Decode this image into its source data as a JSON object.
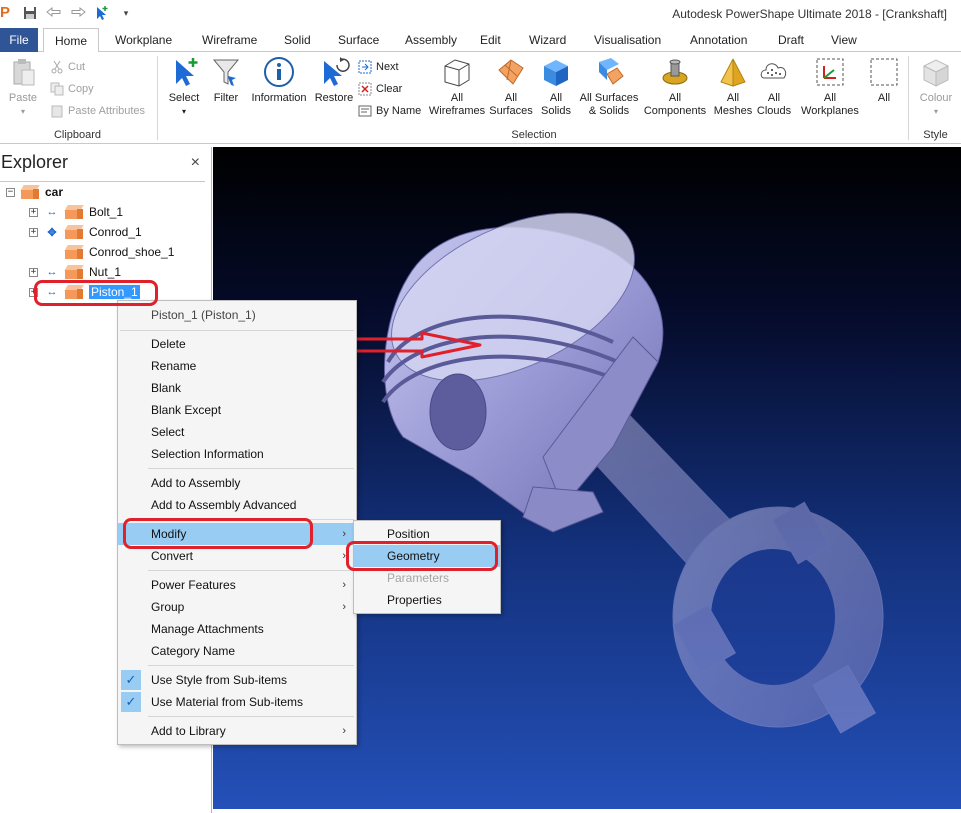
{
  "window": {
    "title": "Autodesk PowerShape Ultimate 2018 - [Crankshaft]",
    "app_logo": "P"
  },
  "ribbon_tabs": [
    "File",
    "Home",
    "Workplane",
    "Wireframe",
    "Solid",
    "Surface",
    "Assembly",
    "Edit",
    "Wizard",
    "Visualisation",
    "Annotation",
    "Draft",
    "View"
  ],
  "ribbon": {
    "clipboard": {
      "label": "Clipboard",
      "paste": "Paste",
      "cut": "Cut",
      "copy": "Copy",
      "paste_attributes": "Paste Attributes"
    },
    "selection": {
      "label": "Selection",
      "select": "Select",
      "filter": "Filter",
      "information": "Information",
      "restore": "Restore",
      "next": "Next",
      "clear": "Clear",
      "by_name": "By Name",
      "all_wireframes": [
        "All",
        "Wireframes"
      ],
      "all_surfaces": [
        "All",
        "Surfaces"
      ],
      "all_solids": [
        "All",
        "Solids"
      ],
      "all_surfaces_solids": [
        "All Surfaces",
        "& Solids"
      ],
      "all_components": [
        "All",
        "Components"
      ],
      "all_meshes": [
        "All",
        "Meshes"
      ],
      "all_clouds": [
        "All",
        "Clouds"
      ],
      "all_workplanes": [
        "All",
        "Workplanes"
      ],
      "all": "All"
    },
    "style": {
      "label": "Style",
      "colour": "Colour"
    }
  },
  "explorer": {
    "title": "Explorer",
    "close": "×",
    "root": "car",
    "items": [
      "Bolt_1",
      "Conrod_1",
      "Conrod_shoe_1",
      "Nut_1",
      "Piston_1"
    ]
  },
  "context_menu": {
    "header": "Piston_1 (Piston_1)",
    "groups": [
      [
        "Delete",
        "Rename",
        "Blank",
        "Blank Except",
        "Select",
        "Selection Information"
      ],
      [
        "Add to Assembly",
        "Add to Assembly Advanced"
      ],
      [
        "Modify",
        "Convert"
      ],
      [
        "Power Features",
        "Group",
        "Manage Attachments",
        "Category Name"
      ],
      [
        "Use Style from Sub-items",
        "Use Material from Sub-items"
      ],
      [
        "Add to Library"
      ]
    ],
    "checkmark": "✓",
    "submenu_arrow": "›"
  },
  "submenu": {
    "items": [
      "Position",
      "Geometry",
      "Parameters",
      "Properties"
    ]
  },
  "colors": {
    "file_tab": "#2f5597",
    "menu_highlight": "#99ccf3",
    "selection": "#3399ff",
    "annotation_red": "#e0202a"
  }
}
